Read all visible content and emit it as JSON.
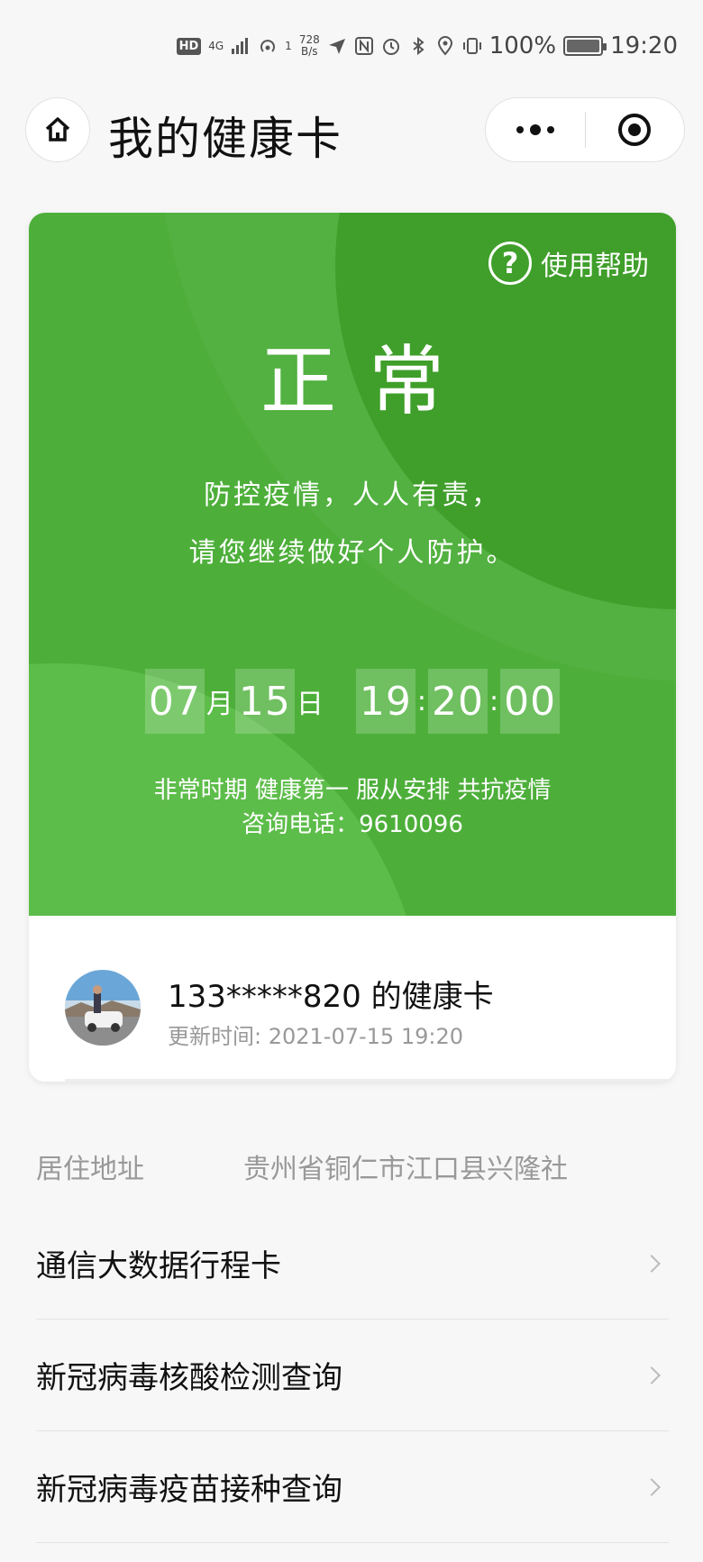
{
  "statusbar": {
    "hd": "HD",
    "network": "4G",
    "hotspot_count": "1",
    "speed_value": "728",
    "speed_unit": "B/s",
    "battery": "100%",
    "time": "19:20"
  },
  "nav": {
    "title": "我的健康卡"
  },
  "card": {
    "help_label": "使用帮助",
    "status": "正常",
    "slogan_line1": "防控疫情，人人有责，",
    "slogan_line2": "请您继续做好个人防护。",
    "clock": {
      "month": "07",
      "month_unit": "月",
      "day": "15",
      "day_unit": "日",
      "hour": "19",
      "minute": "20",
      "second": "00",
      "sep": ":"
    },
    "notice": "非常时期 健康第一 服从安排 共抗疫情",
    "phone": "咨询电话：9610096",
    "owner": "133*****820 的健康卡",
    "updated": "更新时间: 2021-07-15 19:20",
    "colors": {
      "green": "#4daf3a",
      "dark_green": "#3f9f2a",
      "light_green": "#5dbd4a"
    }
  },
  "address": {
    "label": "居住地址",
    "value": "贵州省铜仁市江口县兴隆社"
  },
  "list": [
    {
      "label": "通信大数据行程卡"
    },
    {
      "label": "新冠病毒核酸检测查询"
    },
    {
      "label": "新冠病毒疫苗接种查询"
    }
  ]
}
